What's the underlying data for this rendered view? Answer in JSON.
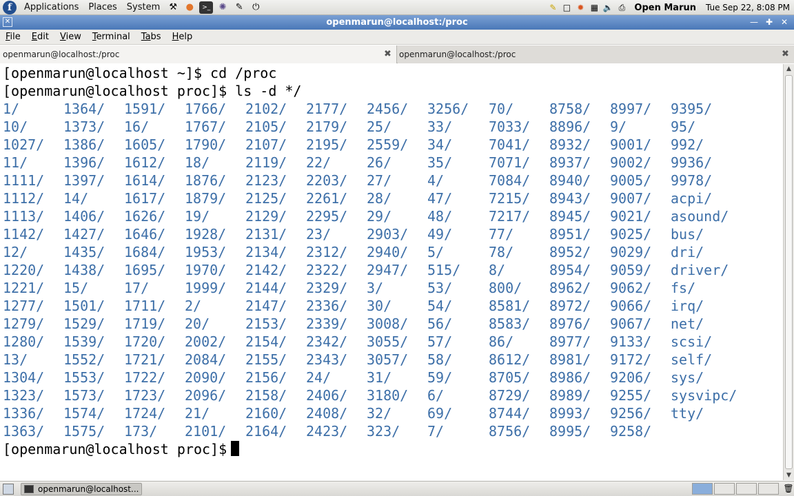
{
  "panel": {
    "menus": [
      "Applications",
      "Places",
      "System"
    ],
    "user": "Open Marun",
    "clock": "Tue Sep 22,  8:08 PM"
  },
  "window": {
    "title": "openmarun@localhost:/proc"
  },
  "menubar": [
    {
      "acc": "F",
      "rest": "ile"
    },
    {
      "acc": "E",
      "rest": "dit"
    },
    {
      "acc": "V",
      "rest": "iew"
    },
    {
      "acc": "T",
      "rest": "erminal"
    },
    {
      "acc": "Ta",
      "rest": "bs"
    },
    {
      "acc": "H",
      "rest": "elp"
    }
  ],
  "tabs": [
    {
      "label": "openmarun@localhost:/proc"
    },
    {
      "label": "openmarun@localhost:/proc"
    }
  ],
  "terminal": {
    "line1": "[openmarun@localhost ~]$ cd /proc",
    "line2": "[openmarun@localhost proc]$ ls -d */",
    "final_prompt": "[openmarun@localhost proc]$",
    "columns": [
      [
        "1/",
        "10/",
        "1027/",
        "11/",
        "1111/",
        "1112/",
        "1113/",
        "1142/",
        "12/",
        "1220/",
        "1221/",
        "1277/",
        "1279/",
        "1280/",
        "13/",
        "1304/",
        "1323/",
        "1336/",
        "1363/"
      ],
      [
        "1364/",
        "1373/",
        "1386/",
        "1396/",
        "1397/",
        "14/",
        "1406/",
        "1427/",
        "1435/",
        "1438/",
        "15/",
        "1501/",
        "1529/",
        "1539/",
        "1552/",
        "1553/",
        "1573/",
        "1574/",
        "1575/"
      ],
      [
        "1591/",
        "16/",
        "1605/",
        "1612/",
        "1614/",
        "1617/",
        "1626/",
        "1646/",
        "1684/",
        "1695/",
        "17/",
        "1711/",
        "1719/",
        "1720/",
        "1721/",
        "1722/",
        "1723/",
        "1724/",
        "173/"
      ],
      [
        "1766/",
        "1767/",
        "1790/",
        "18/",
        "1876/",
        "1879/",
        "19/",
        "1928/",
        "1953/",
        "1970/",
        "1999/",
        "2/",
        "20/",
        "2002/",
        "2084/",
        "2090/",
        "2096/",
        "21/",
        "2101/"
      ],
      [
        "2102/",
        "2105/",
        "2107/",
        "2119/",
        "2123/",
        "2125/",
        "2129/",
        "2131/",
        "2134/",
        "2142/",
        "2144/",
        "2147/",
        "2153/",
        "2154/",
        "2155/",
        "2156/",
        "2158/",
        "2160/",
        "2164/"
      ],
      [
        "2177/",
        "2179/",
        "2195/",
        "22/",
        "2203/",
        "2261/",
        "2295/",
        "23/",
        "2312/",
        "2322/",
        "2329/",
        "2336/",
        "2339/",
        "2342/",
        "2343/",
        "24/",
        "2406/",
        "2408/",
        "2423/"
      ],
      [
        "2456/",
        "25/",
        "2559/",
        "26/",
        "27/",
        "28/",
        "29/",
        "2903/",
        "2940/",
        "2947/",
        "3/",
        "30/",
        "3008/",
        "3055/",
        "3057/",
        "31/",
        "3180/",
        "32/",
        "323/"
      ],
      [
        "3256/",
        "33/",
        "34/",
        "35/",
        "4/",
        "47/",
        "48/",
        "49/",
        "5/",
        "515/",
        "53/",
        "54/",
        "56/",
        "57/",
        "58/",
        "59/",
        "6/",
        "69/",
        "7/"
      ],
      [
        "70/",
        "7033/",
        "7041/",
        "7071/",
        "7084/",
        "7215/",
        "7217/",
        "77/",
        "78/",
        "8/",
        "800/",
        "8581/",
        "8583/",
        "86/",
        "8612/",
        "8705/",
        "8729/",
        "8744/",
        "8756/"
      ],
      [
        "8758/",
        "8896/",
        "8932/",
        "8937/",
        "8940/",
        "8943/",
        "8945/",
        "8951/",
        "8952/",
        "8954/",
        "8962/",
        "8972/",
        "8976/",
        "8977/",
        "8981/",
        "8986/",
        "8989/",
        "8993/",
        "8995/"
      ],
      [
        "8997/",
        "9/",
        "9001/",
        "9002/",
        "9005/",
        "9007/",
        "9021/",
        "9025/",
        "9029/",
        "9059/",
        "9062/",
        "9066/",
        "9067/",
        "9133/",
        "9172/",
        "9206/",
        "9255/",
        "9256/",
        "9258/"
      ],
      [
        "9395/",
        "95/",
        "992/",
        "9936/",
        "9978/",
        "acpi/",
        "asound/",
        "bus/",
        "dri/",
        "driver/",
        "fs/",
        "irq/",
        "net/",
        "scsi/",
        "self/",
        "sys/",
        "sysvipc/",
        "tty/"
      ]
    ]
  },
  "taskbar": {
    "task_label": "openmarun@localhost..."
  },
  "colors": {
    "directory": "#3d6fa8",
    "titlebar": "#4a78b8"
  }
}
